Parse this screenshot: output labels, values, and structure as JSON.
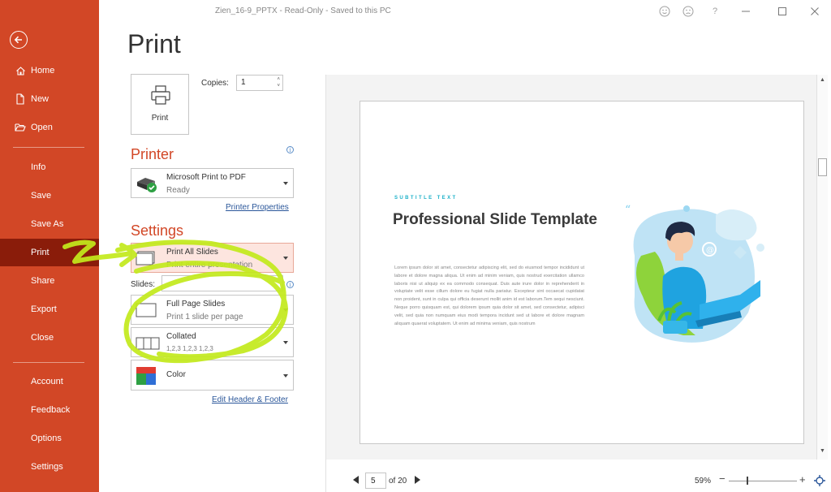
{
  "window": {
    "title": "Zien_16-9_PPTX  -  Read-Only  -  Saved to this PC",
    "help": "?"
  },
  "sidebar": {
    "items": [
      {
        "label": "Home",
        "icon": "home-icon"
      },
      {
        "label": "New",
        "icon": "new-file-icon"
      },
      {
        "label": "Open",
        "icon": "folder-open-icon"
      },
      {
        "label": "Info"
      },
      {
        "label": "Save"
      },
      {
        "label": "Save As"
      },
      {
        "label": "Print",
        "active": true
      },
      {
        "label": "Share"
      },
      {
        "label": "Export"
      },
      {
        "label": "Close"
      },
      {
        "label": "Account"
      },
      {
        "label": "Feedback"
      },
      {
        "label": "Options"
      },
      {
        "label": "Settings"
      }
    ]
  },
  "main": {
    "heading": "Print",
    "print_button": "Print",
    "copies_label": "Copies:",
    "copies_value": "1",
    "printer": {
      "section": "Printer",
      "name": "Microsoft Print to PDF",
      "status": "Ready",
      "properties_link": "Printer Properties"
    },
    "settings": {
      "section": "Settings",
      "slides_range": {
        "title": "Print All Slides",
        "desc": "Print entire presentation"
      },
      "slides_label": "Slides:",
      "layout": {
        "title": "Full Page Slides",
        "desc": "Print 1 slide per page"
      },
      "collation": {
        "title": "Collated",
        "desc": "1,2,3    1,2,3    1,2,3"
      },
      "color": {
        "title": "Color"
      },
      "header_footer_link": "Edit Header & Footer"
    }
  },
  "preview": {
    "slide": {
      "subtitle": "SUBTITLE TEXT",
      "title": "Professional Slide Template",
      "body": "Lorem ipsum dolor sit amet, consectetur adipiscing elit, sed do eiusmod tempor incididunt ut labore et dolore magna aliqua. Ut enim ad minim veniam, quis nostrud exercitation ullamco laboris nisi ut aliquip ex ea commodo consequat. Duis aute irure dolor in reprehenderit in voluptate velit esse cillum dolore eu fugiat nulla pariatur. Excepteur sint occaecat cupidatat non proident, sunt in culpa qui officia deserunt mollit anim id est laborum.Tem sequi nesciunt. Neque porro quisquam est, qui dolorem ipsum quia dolor sit amet, sed consectetur, adipisci velit, sed quia non numquam eius modi tempora incidunt sed ut labore et dolore magnam aliquam quaerat voluptatem. Ut enim ad minima veniam, quis nostrum"
    },
    "page_current": "5",
    "page_total_text": "of 20",
    "zoom": "59%"
  },
  "colors": {
    "sidebar": "#d24726",
    "sidebar_active": "#8a1c0a",
    "accent_text": "#d24726",
    "link": "#2b579a",
    "annotation": "#c3ea1c"
  }
}
